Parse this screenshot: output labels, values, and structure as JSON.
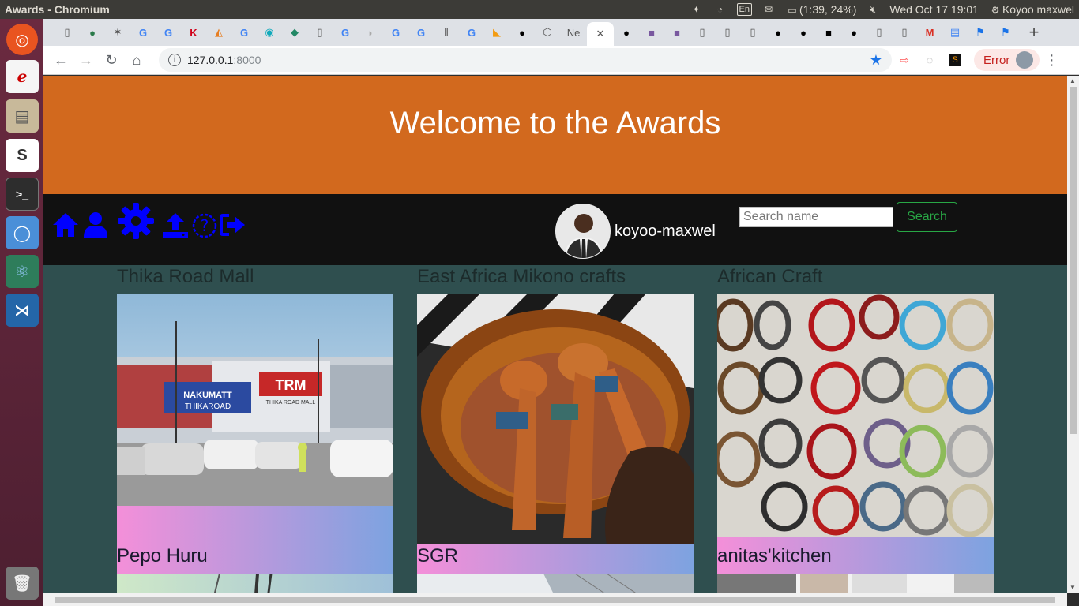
{
  "os": {
    "window_title": "Awards - Chromium",
    "battery": "(1:39, 24%)",
    "keyboard": "En",
    "datetime": "Wed Oct 17 19:01",
    "user": "Koyoo maxwel"
  },
  "browser": {
    "tab_label_ne": "Ne",
    "url_host": "127.0.0.1",
    "url_port": ":8000",
    "error_label": "Error"
  },
  "page": {
    "hero_title": "Welcome to the Awards",
    "username": "koyoo-maxwel",
    "search_placeholder": "Search name",
    "search_button": "Search",
    "cards": [
      {
        "title": "Thika Road Mall",
        "caption": "Pepo Huru"
      },
      {
        "title": "East Africa Mikono crafts",
        "caption": "SGR"
      },
      {
        "title": "African Craft",
        "caption": "anitas'kitchen"
      }
    ],
    "image_signs": {
      "trm": "TRM",
      "trm_sub": "THIKA ROAD MALL",
      "nakumatt": "NAKUMATT",
      "thikaroad": "THIKAROAD"
    }
  },
  "colors": {
    "hero": "#d2691e",
    "nav": "#111111",
    "body": "#2f4f4f",
    "nav_icons": "#0000ff",
    "search_accent": "#28a745"
  }
}
